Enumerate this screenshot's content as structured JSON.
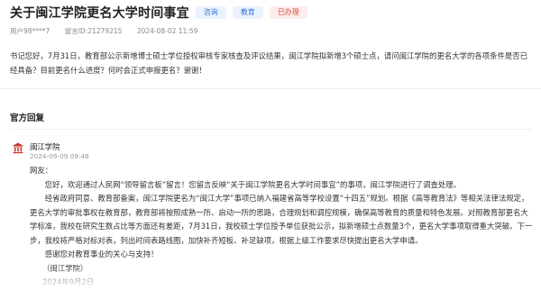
{
  "header": {
    "title": "关于闽江学院更名大学时间事宜",
    "tags": [
      {
        "label": "咨询",
        "color": "#3a74d6"
      },
      {
        "label": "教育",
        "color": "#3a74d6"
      },
      {
        "label": "已办理",
        "color": "#e24b42"
      }
    ]
  },
  "meta": {
    "user": "用户98****7",
    "id": "留言ID:21279215",
    "time": "2024-08-02 11:59"
  },
  "letter": {
    "body": "书记您好，7月31日，教育部公示新增博士硕士学位授权审核专家核查及评议结果，闽江学院拟新增3个硕士点，请问闽江学院的更名大学的各项条件是否已经具备？目前更名什么进度？何时会正式申报更名？谢谢！"
  },
  "reply_section": {
    "title": "官方回复",
    "org_name": "闽江学院",
    "org_time": "2024-09-09 09:46",
    "salutation": "网友：",
    "paragraphs": [
      "您好，欢迎通过人民网“领导留言板”留言！您留言反映“关于闽江学院更名大学时间事宜”的事项，闽江学院进行了调查处理。",
      "经省政府同意、教育部备案，闽江学院更名为“闽江大学”事项已纳入福建省高等学校设置“十四五”规划。根据《高等教育法》等相关法律法规定，更名大学的审批事权在教育部，教育部将按照成熟一所、启动一所的思路，合理规划和调控规模，确保高等教育的质量和特色发展。对照教育部更名大学标准，我校在研究生数占比等方面还有差距，7月31日，我校硕士学位授予单位获批公示，拟新增硕士点数量3个，更名大学事项取得重大突破。下一步，我校将严格对标对表，列出时间表路线图，加快补齐短板、补足缺项，根据上级工作要求尽快提出更名大学申请。",
      "感谢您对教育事业的关心与支持！"
    ],
    "signature": "（闽江学院）",
    "date": "2024年9月2日"
  },
  "icons": {
    "org_icon": "building-icon"
  }
}
